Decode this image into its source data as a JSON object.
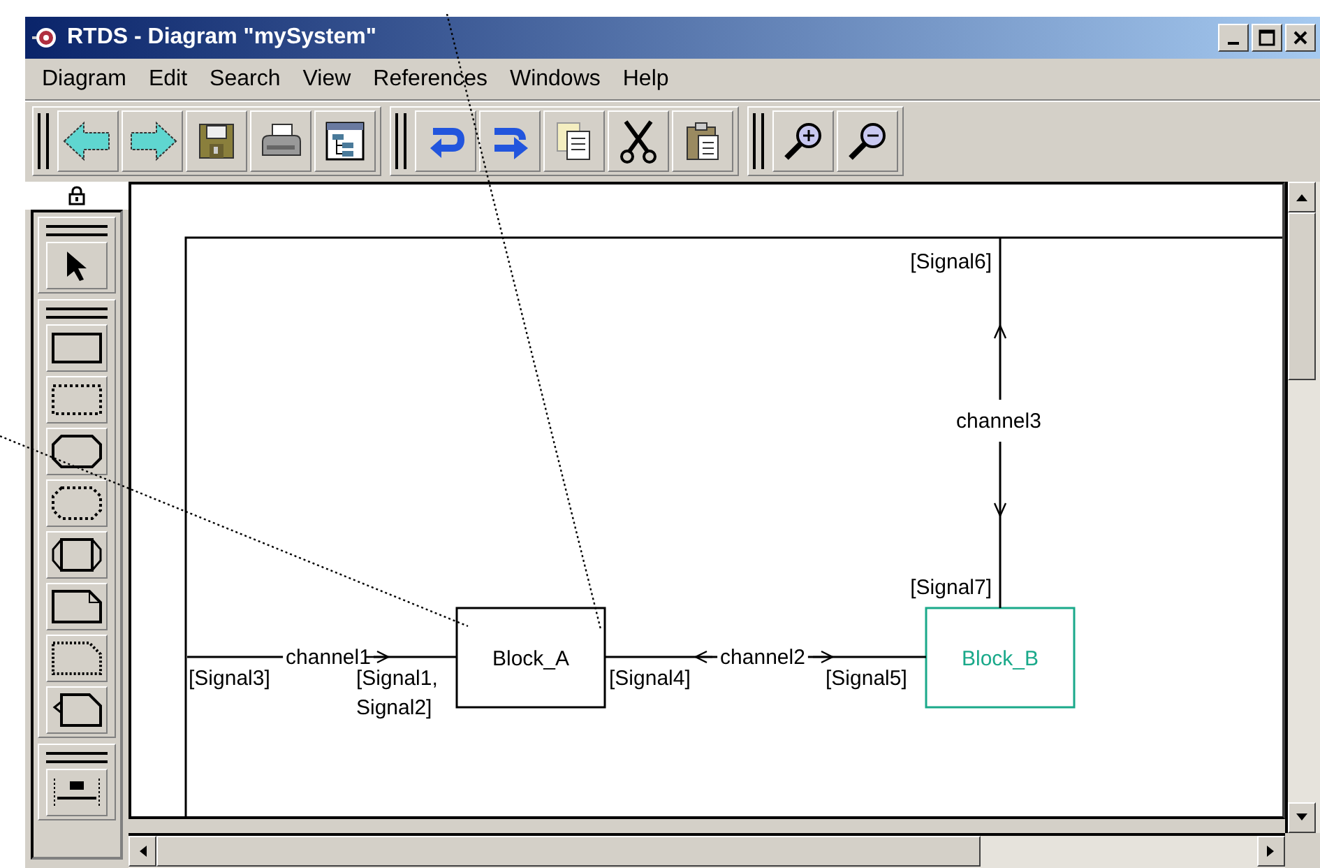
{
  "window": {
    "title": "RTDS - Diagram \"mySystem\""
  },
  "menu": [
    "Diagram",
    "Edit",
    "Search",
    "View",
    "References",
    "Windows",
    "Help"
  ],
  "diagram": {
    "blocks": [
      {
        "name": "Block_A",
        "color": "#000000"
      },
      {
        "name": "Block_B",
        "color": "#1aa98a"
      }
    ],
    "channels": [
      {
        "name": "channel1"
      },
      {
        "name": "channel2"
      },
      {
        "name": "channel3"
      }
    ],
    "signal_lists": [
      "[Signal3]",
      "[Signal1,\nSignal2]",
      "[Signal4]",
      "[Signal5]",
      "[Signal6]",
      "[Signal7]"
    ]
  }
}
